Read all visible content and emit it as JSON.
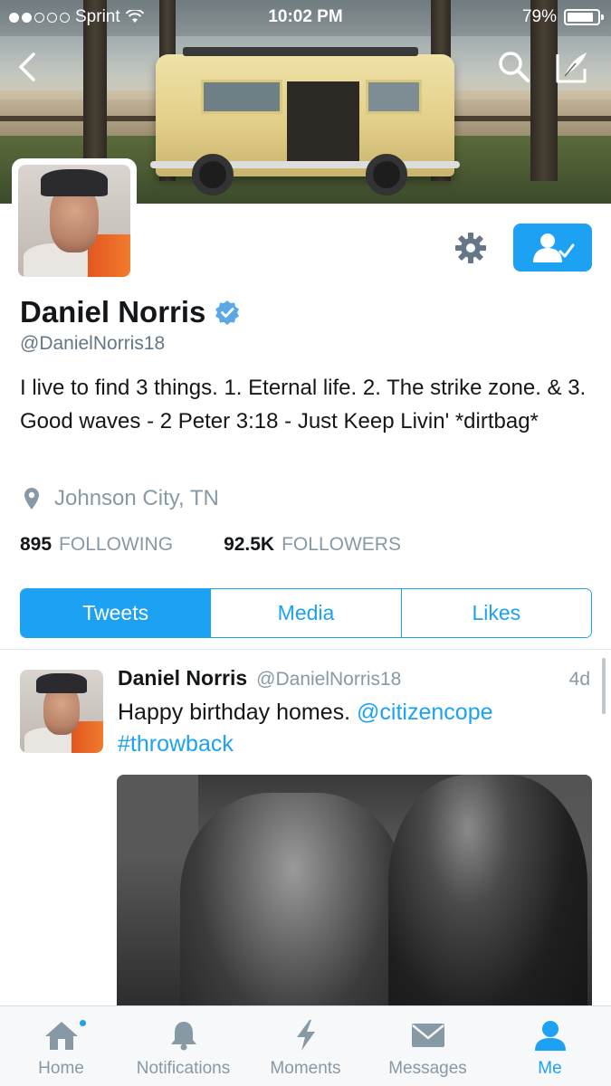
{
  "status_bar": {
    "carrier": "Sprint",
    "time": "10:02 PM",
    "battery": "79%",
    "battery_level": 0.79,
    "signal_bars_filled": 2,
    "signal_bars_total": 5
  },
  "profile": {
    "name": "Daniel Norris",
    "verified": true,
    "handle": "@DanielNorris18",
    "bio": "I live to find 3 things. 1. Eternal life. 2. The strike zone. & 3. Good waves - 2 Peter 3:18 - Just Keep Livin' *dirtbag*",
    "location": "Johnson City, TN",
    "following_count": "895",
    "following_label": "FOLLOWING",
    "followers_count": "92.5K",
    "followers_label": "FOLLOWERS"
  },
  "tabs": [
    {
      "label": "Tweets",
      "active": true
    },
    {
      "label": "Media",
      "active": false
    },
    {
      "label": "Likes",
      "active": false
    }
  ],
  "tweet": {
    "name": "Daniel Norris",
    "handle": "@DanielNorris18",
    "time": "4d",
    "text_plain": "Happy birthday homes.",
    "mention": "@citizencope",
    "hashtag": "#throwback"
  },
  "bottom_nav": [
    {
      "label": "Home",
      "icon": "home-icon",
      "active": false,
      "has_dot": true
    },
    {
      "label": "Notifications",
      "icon": "bell-icon",
      "active": false
    },
    {
      "label": "Moments",
      "icon": "lightning-icon",
      "active": false
    },
    {
      "label": "Messages",
      "icon": "envelope-icon",
      "active": false
    },
    {
      "label": "Me",
      "icon": "person-icon",
      "active": true
    }
  ],
  "colors": {
    "accent": "#1da1f2",
    "muted": "#8899a6",
    "text": "#14171a",
    "verified": "#1da1f2"
  }
}
